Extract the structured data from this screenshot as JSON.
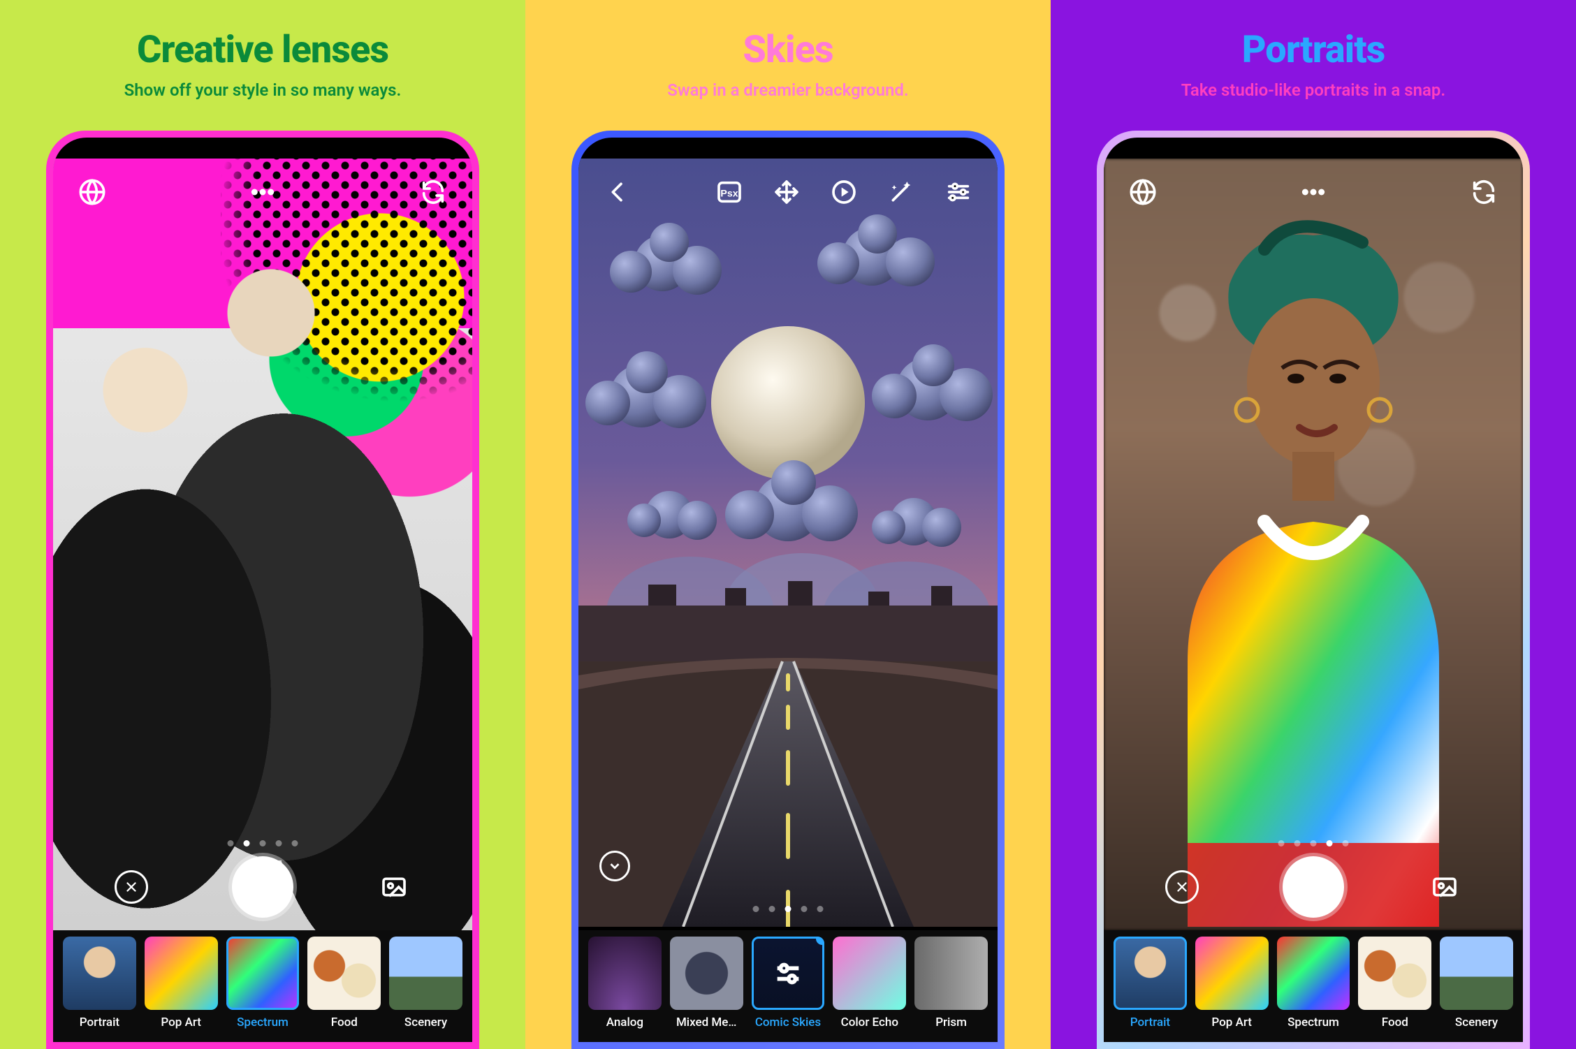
{
  "panels": [
    {
      "title": "Creative lenses",
      "subtitle": "Show off your style in so many ways.",
      "pager": {
        "count": 5,
        "active": 1
      },
      "filters": [
        {
          "label": "Portrait"
        },
        {
          "label": "Pop Art"
        },
        {
          "label": "Spectrum",
          "selected": true
        },
        {
          "label": "Food"
        },
        {
          "label": "Scenery"
        }
      ]
    },
    {
      "title": "Skies",
      "subtitle": "Swap in a dreamier background.",
      "pager": {
        "count": 5,
        "active": 2
      },
      "filters": [
        {
          "label": "Analog"
        },
        {
          "label": "Mixed Me…"
        },
        {
          "label": "Comic Skies",
          "selected": true,
          "badge": true
        },
        {
          "label": "Color Echo"
        },
        {
          "label": "Prism"
        }
      ]
    },
    {
      "title": "Portraits",
      "subtitle": "Take studio-like portraits in a snap.",
      "pager": {
        "count": 5,
        "active": 3
      },
      "filters": [
        {
          "label": "Portrait",
          "selected": true
        },
        {
          "label": "Pop Art"
        },
        {
          "label": "Spectrum"
        },
        {
          "label": "Food"
        },
        {
          "label": "Scenery"
        }
      ]
    }
  ]
}
